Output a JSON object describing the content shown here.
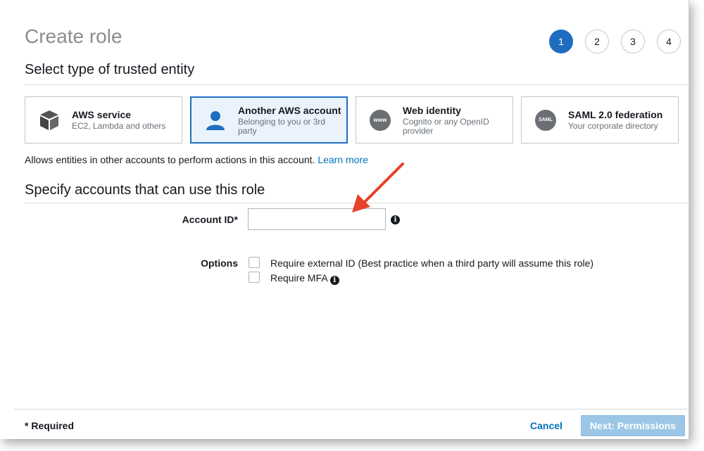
{
  "page": {
    "title": "Create role",
    "steps": [
      "1",
      "2",
      "3",
      "4"
    ],
    "active_step": "1"
  },
  "entity": {
    "heading": "Select type of trusted entity",
    "cards": [
      {
        "title": "AWS service",
        "subtitle": "EC2, Lambda and others",
        "icon": "cube-icon",
        "selected": false
      },
      {
        "title": "Another AWS account",
        "subtitle": "Belonging to you or 3rd party",
        "icon": "user-icon",
        "selected": true
      },
      {
        "title": "Web identity",
        "subtitle": "Cognito or any OpenID provider",
        "icon_text": "www",
        "icon": "www-icon",
        "selected": false
      },
      {
        "title": "SAML 2.0 federation",
        "subtitle": "Your corporate directory",
        "icon_text": "SAML",
        "icon": "saml-icon",
        "selected": false
      }
    ],
    "description": "Allows entities in other accounts to perform actions in this account.",
    "learn_more": "Learn more"
  },
  "accounts": {
    "heading": "Specify accounts that can use this role",
    "account_id_label": "Account ID*",
    "account_id_value": "",
    "options_label": "Options",
    "options": [
      {
        "label": "Require external ID (Best practice when a third party will assume this role)",
        "checked": false
      },
      {
        "label": "Require MFA",
        "checked": false
      }
    ]
  },
  "footer": {
    "required_note": "* Required",
    "cancel": "Cancel",
    "next": "Next: Permissions"
  },
  "colors": {
    "accent": "#1f6dbf",
    "link": "#0073bb",
    "arrow": "#e8402a",
    "next_disabled": "#9cc6e6"
  }
}
